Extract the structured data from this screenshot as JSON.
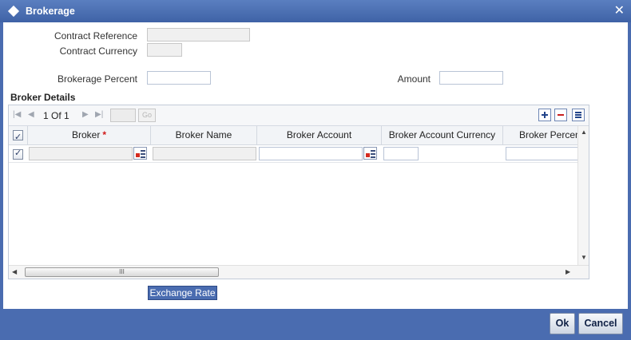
{
  "window": {
    "title": "Brokerage",
    "close_label": "✕"
  },
  "form": {
    "contract_reference": {
      "label": "Contract Reference",
      "value": ""
    },
    "contract_currency": {
      "label": "Contract Currency",
      "value": ""
    },
    "brokerage_percent": {
      "label": "Brokerage Percent",
      "value": ""
    },
    "amount": {
      "label": "Amount",
      "value": ""
    }
  },
  "broker_details": {
    "title": "Broker Details",
    "pagination": {
      "current": "1",
      "of_label": "Of",
      "total": "1",
      "go_label": "Go",
      "page_input": ""
    },
    "columns": [
      "Broker",
      "Broker Name",
      "Broker Account",
      "Broker Account Currency",
      "Broker Percentage"
    ],
    "required_marker": "*",
    "scroll_thumb": "III",
    "rows": [
      {
        "selected": true,
        "broker": "",
        "broker_name": "",
        "broker_account": "",
        "broker_account_currency": "",
        "broker_percentage": ""
      }
    ]
  },
  "buttons": {
    "exchange_rate": "Exchange Rate",
    "ok": "Ok",
    "cancel": "Cancel"
  },
  "colors": {
    "titlebar": "#4a6cb0",
    "footer": "#4a6cb0",
    "required": "#d01818"
  }
}
